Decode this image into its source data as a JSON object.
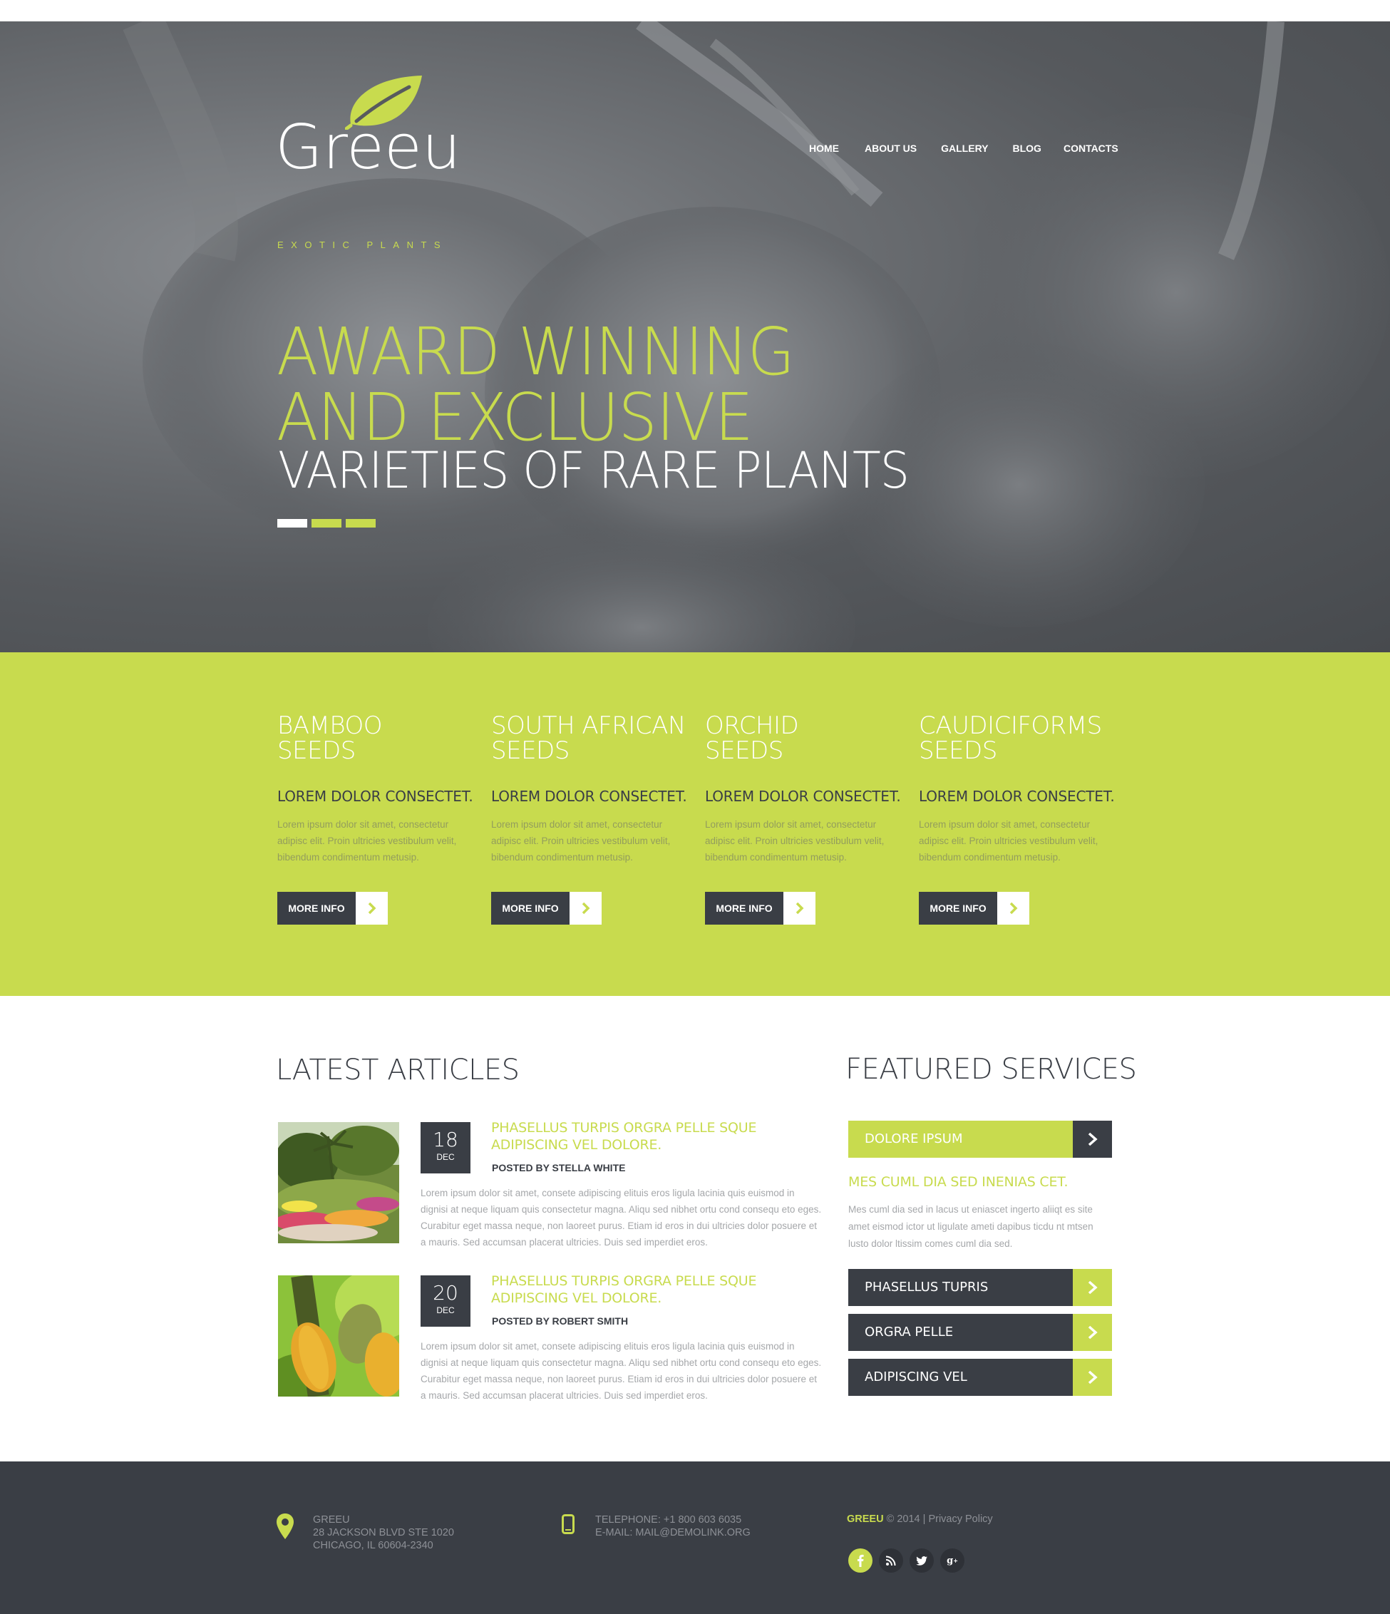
{
  "brand": {
    "name": "Greeu",
    "tagline": "EXOTIC PLANTS"
  },
  "nav": [
    {
      "label": "HOME"
    },
    {
      "label": "ABOUT US"
    },
    {
      "label": "GALLERY"
    },
    {
      "label": "BLOG"
    },
    {
      "label": "CONTACTS"
    }
  ],
  "hero": {
    "line1": "AWARD WINNING",
    "line2": "AND EXCLUSIVE",
    "line3": "VARIETIES OF RARE PLANTS",
    "slides": 3,
    "active_slide": 1
  },
  "seeds": [
    {
      "title1": "BAMBOO",
      "title2": "SEEDS",
      "subtitle": "LOREM DOLOR CONSECTET.",
      "text": "Lorem ipsum dolor sit amet, consectetur adipisc elit. Proin ultricies vestibulum velit, bibendum condimentum metusip.",
      "button": "MORE INFO"
    },
    {
      "title1": "SOUTH AFRICAN",
      "title2": "SEEDS",
      "subtitle": "LOREM DOLOR CONSECTET.",
      "text": "Lorem ipsum dolor sit amet, consectetur adipisc elit. Proin ultricies vestibulum velit, bibendum condimentum metusip.",
      "button": "MORE INFO"
    },
    {
      "title1": "ORCHID",
      "title2": "SEEDS",
      "subtitle": "LOREM DOLOR CONSECTET.",
      "text": "Lorem ipsum dolor sit amet, consectetur adipisc elit. Proin ultricies vestibulum velit, bibendum condimentum metusip.",
      "button": "MORE INFO"
    },
    {
      "title1": "CAUDICIFORMS",
      "title2": "SEEDS",
      "subtitle": "LOREM DOLOR CONSECTET.",
      "text": "Lorem ipsum dolor sit amet, consectetur adipisc elit. Proin ultricies vestibulum velit, bibendum condimentum metusip.",
      "button": "MORE INFO"
    }
  ],
  "articles": {
    "heading": "LATEST ARTICLES",
    "items": [
      {
        "day": "18",
        "month": "DEC",
        "title": "PHASELLUS TURPIS ORGRA PELLE SQUE ADIPISCING VEL DOLORE.",
        "author": "POSTED BY STELLA WHITE",
        "text": "Lorem ipsum dolor sit amet, consete adipiscing elituis eros ligula lacinia quis euismod in dignisi at neque liquam quis consectetur magna. Aliqu sed nibhet ortu cond consequ eto eges. Curabitur eget massa neque, non laoreet purus. Etiam id eros in dui ultricies dolor posuere et a mauris. Sed accumsan placerat ultricies. Duis sed imperdiet eros.",
        "image": "garden-photo"
      },
      {
        "day": "20",
        "month": "DEC",
        "title": "PHASELLUS TURPIS ORGRA PELLE SQUE ADIPISCING VEL DOLORE.",
        "author": "POSTED BY ROBERT SMITH",
        "text": "Lorem ipsum dolor sit amet, consete adipiscing elituis eros ligula lacinia quis euismod in dignisi at neque liquam quis consectetur magna. Aliqu sed nibhet ortu cond consequ eto eges. Curabitur eget massa neque, non laoreet purus. Etiam id eros in dui ultricies dolor posuere et a mauris. Sed accumsan placerat ultricies. Duis sed imperdiet eros.",
        "image": "cacao-pods-photo"
      }
    ]
  },
  "services": {
    "heading": "FEATURED SERVICES",
    "active": "DOLORE IPSUM",
    "subtitle": "MES CUML DIA SED INENIAS CET.",
    "text": "Mes cuml dia sed in lacus ut eniascet ingerto aliiqt es site amet eismod ictor ut ligulate ameti dapibus ticdu nt mtsen lusto dolor ltissim comes cuml dia sed.",
    "items": [
      {
        "label": "PHASELLUS TUPRIS"
      },
      {
        "label": "ORGRA PELLE"
      },
      {
        "label": "ADIPISCING VEL"
      }
    ]
  },
  "footer": {
    "address": {
      "line1": "GREEU",
      "line2": "28 JACKSON BLVD STE 1020",
      "line3": "CHICAGO, IL 60604-2340"
    },
    "contact": {
      "phone": "TELEPHONE: +1 800 603 6035",
      "email": "E-MAIL: MAIL@DEMOLINK.ORG"
    },
    "copyright": {
      "brand": "GREEU",
      "year": "© 2014",
      "sep": "|",
      "policy": "Privacy Policy"
    },
    "social": [
      {
        "icon": "facebook-icon",
        "glyph": "f"
      },
      {
        "icon": "rss-icon",
        "glyph": "))"
      },
      {
        "icon": "twitter-icon",
        "glyph": "t"
      },
      {
        "icon": "google-plus-icon",
        "glyph": "g+"
      }
    ]
  },
  "colors": {
    "accent": "#c8db4e",
    "dark": "#3a3e45",
    "text_muted": "#a5a7aa"
  }
}
